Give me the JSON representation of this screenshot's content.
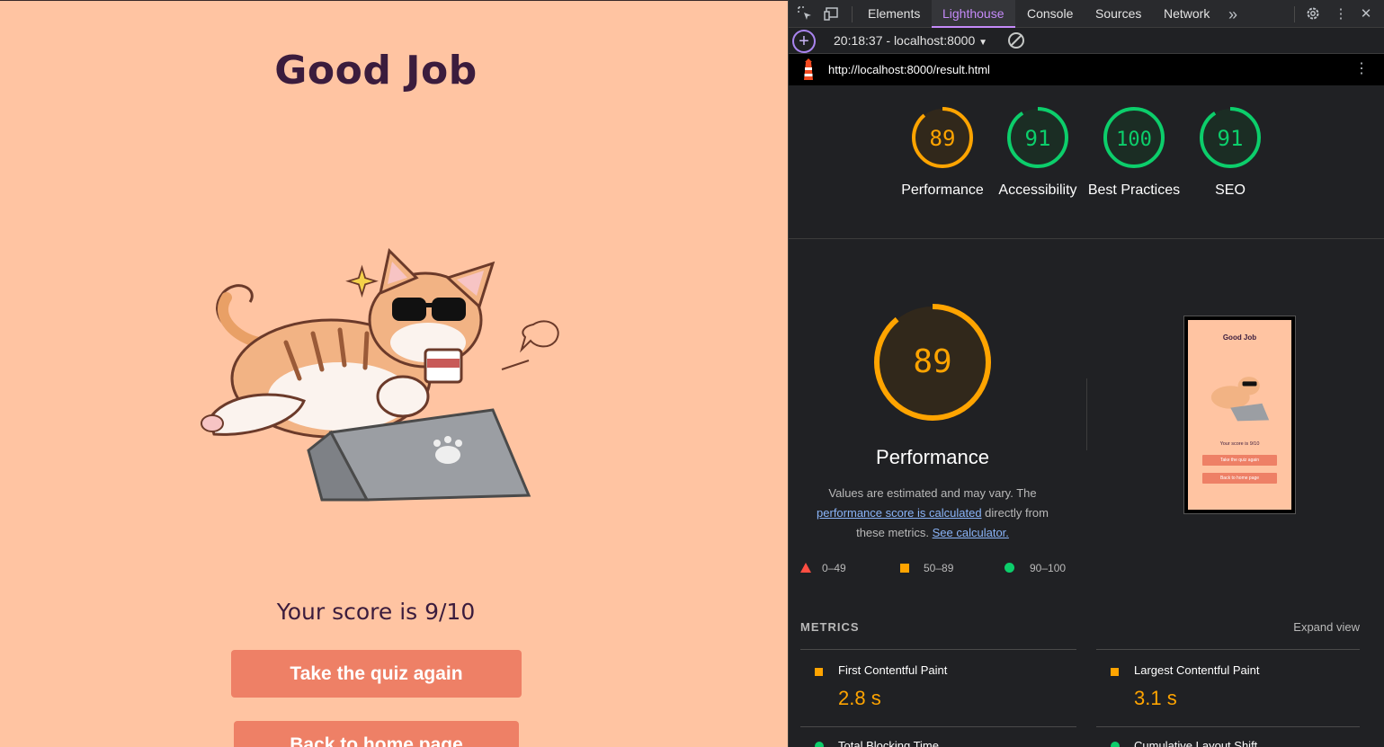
{
  "app": {
    "title": "Good Job",
    "score_text": "Your score is 9/10",
    "retry_button": "Take the quiz again",
    "home_button": "Back to home page"
  },
  "devtools": {
    "tabs": [
      "Elements",
      "Lighthouse",
      "Console",
      "Sources",
      "Network"
    ],
    "active_tab": "Lighthouse",
    "run_label": "20:18:37 - localhost:8000",
    "url": "http://localhost:8000/result.html",
    "gauges": [
      {
        "score": "89",
        "label": "Performance",
        "color": "#ffa400"
      },
      {
        "score": "91",
        "label": "Accessibility",
        "color": "#0cce6b"
      },
      {
        "score": "100",
        "label": "Best Practices",
        "color": "#0cce6b"
      },
      {
        "score": "91",
        "label": "SEO",
        "color": "#0cce6b"
      }
    ],
    "performance": {
      "score": "89",
      "title": "Performance",
      "desc_prefix": "Values are estimated and may vary. The ",
      "desc_link": "performance score is calculated",
      "desc_mid": " directly from these metrics. ",
      "desc_link2": "See calculator."
    },
    "legend": {
      "fail": "0–49",
      "average": "50–89",
      "pass": "90–100"
    },
    "metrics_header": "METRICS",
    "expand_view": "Expand view",
    "metrics": [
      {
        "label": "First Contentful Paint",
        "value": "2.8 s"
      },
      {
        "label": "Largest Contentful Paint",
        "value": "3.1 s"
      }
    ],
    "metrics_next": [
      "Total Blocking Time",
      "Cumulative Layout Shift"
    ]
  }
}
